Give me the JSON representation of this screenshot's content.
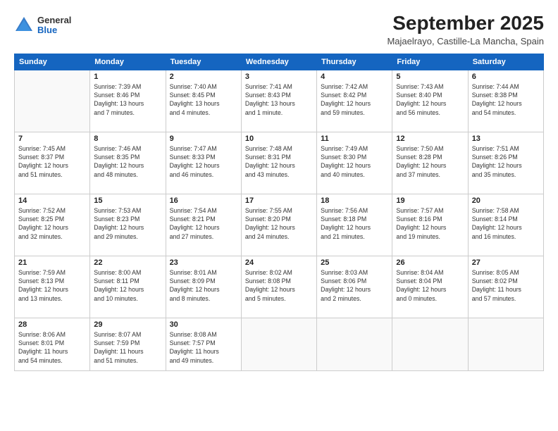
{
  "header": {
    "logo": {
      "line1": "General",
      "line2": "Blue"
    },
    "title": "September 2025",
    "subtitle": "Majaelrayo, Castille-La Mancha, Spain"
  },
  "weekdays": [
    "Sunday",
    "Monday",
    "Tuesday",
    "Wednesday",
    "Thursday",
    "Friday",
    "Saturday"
  ],
  "weeks": [
    [
      {
        "day": "",
        "info": ""
      },
      {
        "day": "1",
        "info": "Sunrise: 7:39 AM\nSunset: 8:46 PM\nDaylight: 13 hours\nand 7 minutes."
      },
      {
        "day": "2",
        "info": "Sunrise: 7:40 AM\nSunset: 8:45 PM\nDaylight: 13 hours\nand 4 minutes."
      },
      {
        "day": "3",
        "info": "Sunrise: 7:41 AM\nSunset: 8:43 PM\nDaylight: 13 hours\nand 1 minute."
      },
      {
        "day": "4",
        "info": "Sunrise: 7:42 AM\nSunset: 8:42 PM\nDaylight: 12 hours\nand 59 minutes."
      },
      {
        "day": "5",
        "info": "Sunrise: 7:43 AM\nSunset: 8:40 PM\nDaylight: 12 hours\nand 56 minutes."
      },
      {
        "day": "6",
        "info": "Sunrise: 7:44 AM\nSunset: 8:38 PM\nDaylight: 12 hours\nand 54 minutes."
      }
    ],
    [
      {
        "day": "7",
        "info": "Sunrise: 7:45 AM\nSunset: 8:37 PM\nDaylight: 12 hours\nand 51 minutes."
      },
      {
        "day": "8",
        "info": "Sunrise: 7:46 AM\nSunset: 8:35 PM\nDaylight: 12 hours\nand 48 minutes."
      },
      {
        "day": "9",
        "info": "Sunrise: 7:47 AM\nSunset: 8:33 PM\nDaylight: 12 hours\nand 46 minutes."
      },
      {
        "day": "10",
        "info": "Sunrise: 7:48 AM\nSunset: 8:31 PM\nDaylight: 12 hours\nand 43 minutes."
      },
      {
        "day": "11",
        "info": "Sunrise: 7:49 AM\nSunset: 8:30 PM\nDaylight: 12 hours\nand 40 minutes."
      },
      {
        "day": "12",
        "info": "Sunrise: 7:50 AM\nSunset: 8:28 PM\nDaylight: 12 hours\nand 37 minutes."
      },
      {
        "day": "13",
        "info": "Sunrise: 7:51 AM\nSunset: 8:26 PM\nDaylight: 12 hours\nand 35 minutes."
      }
    ],
    [
      {
        "day": "14",
        "info": "Sunrise: 7:52 AM\nSunset: 8:25 PM\nDaylight: 12 hours\nand 32 minutes."
      },
      {
        "day": "15",
        "info": "Sunrise: 7:53 AM\nSunset: 8:23 PM\nDaylight: 12 hours\nand 29 minutes."
      },
      {
        "day": "16",
        "info": "Sunrise: 7:54 AM\nSunset: 8:21 PM\nDaylight: 12 hours\nand 27 minutes."
      },
      {
        "day": "17",
        "info": "Sunrise: 7:55 AM\nSunset: 8:20 PM\nDaylight: 12 hours\nand 24 minutes."
      },
      {
        "day": "18",
        "info": "Sunrise: 7:56 AM\nSunset: 8:18 PM\nDaylight: 12 hours\nand 21 minutes."
      },
      {
        "day": "19",
        "info": "Sunrise: 7:57 AM\nSunset: 8:16 PM\nDaylight: 12 hours\nand 19 minutes."
      },
      {
        "day": "20",
        "info": "Sunrise: 7:58 AM\nSunset: 8:14 PM\nDaylight: 12 hours\nand 16 minutes."
      }
    ],
    [
      {
        "day": "21",
        "info": "Sunrise: 7:59 AM\nSunset: 8:13 PM\nDaylight: 12 hours\nand 13 minutes."
      },
      {
        "day": "22",
        "info": "Sunrise: 8:00 AM\nSunset: 8:11 PM\nDaylight: 12 hours\nand 10 minutes."
      },
      {
        "day": "23",
        "info": "Sunrise: 8:01 AM\nSunset: 8:09 PM\nDaylight: 12 hours\nand 8 minutes."
      },
      {
        "day": "24",
        "info": "Sunrise: 8:02 AM\nSunset: 8:08 PM\nDaylight: 12 hours\nand 5 minutes."
      },
      {
        "day": "25",
        "info": "Sunrise: 8:03 AM\nSunset: 8:06 PM\nDaylight: 12 hours\nand 2 minutes."
      },
      {
        "day": "26",
        "info": "Sunrise: 8:04 AM\nSunset: 8:04 PM\nDaylight: 12 hours\nand 0 minutes."
      },
      {
        "day": "27",
        "info": "Sunrise: 8:05 AM\nSunset: 8:02 PM\nDaylight: 11 hours\nand 57 minutes."
      }
    ],
    [
      {
        "day": "28",
        "info": "Sunrise: 8:06 AM\nSunset: 8:01 PM\nDaylight: 11 hours\nand 54 minutes."
      },
      {
        "day": "29",
        "info": "Sunrise: 8:07 AM\nSunset: 7:59 PM\nDaylight: 11 hours\nand 51 minutes."
      },
      {
        "day": "30",
        "info": "Sunrise: 8:08 AM\nSunset: 7:57 PM\nDaylight: 11 hours\nand 49 minutes."
      },
      {
        "day": "",
        "info": ""
      },
      {
        "day": "",
        "info": ""
      },
      {
        "day": "",
        "info": ""
      },
      {
        "day": "",
        "info": ""
      }
    ]
  ]
}
